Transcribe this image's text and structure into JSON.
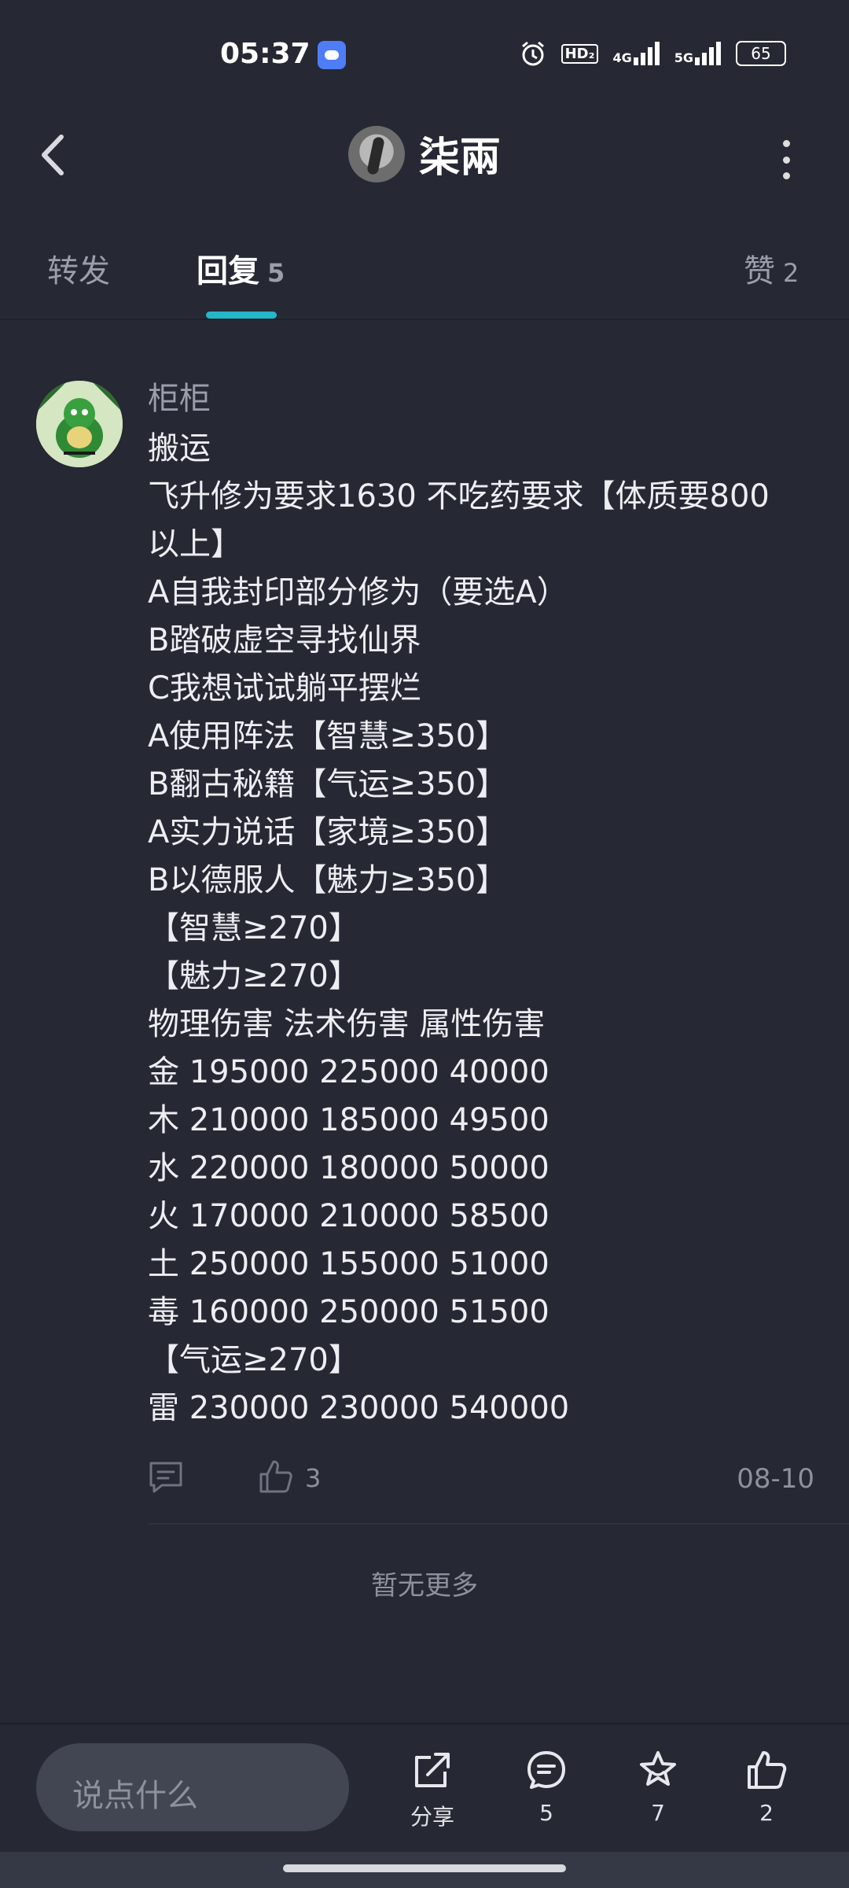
{
  "status_bar": {
    "time": "05:37",
    "hd_label": "HD₂",
    "net1": "4G",
    "net2": "5G",
    "battery": "65"
  },
  "header": {
    "title": "柒兩"
  },
  "tabs": [
    {
      "label": "转发",
      "count": ""
    },
    {
      "label": "回复",
      "count": "5"
    },
    {
      "label": "赞",
      "count": "2"
    }
  ],
  "comment": {
    "username": "柜柜",
    "lines": [
      "搬运",
      "飞升修为要求1630 不吃药要求【体质要800",
      "以上】",
      "A自我封印部分修为（要选A）",
      "B踏破虚空寻找仙界",
      "C我想试试躺平摆烂",
      "A使用阵法【智慧≥350】",
      "B翻古秘籍【气运≥350】",
      "A实力说话【家境≥350】",
      "B以德服人【魅力≥350】",
      "【智慧≥270】",
      "【魅力≥270】",
      "物理伤害 法术伤害 属性伤害",
      "金 195000 225000 40000",
      "木 210000 185000 49500",
      "水 220000 180000 50000",
      "火 170000 210000 58500",
      "土 250000 155000 51000",
      "毒 160000 250000 51500",
      "【气运≥270】",
      "雷 230000 230000 540000"
    ],
    "like_count": "3",
    "date": "08-10"
  },
  "no_more": "暂无更多",
  "bottom_bar": {
    "input_placeholder": "说点什么",
    "share_label": "分享",
    "comment_count": "5",
    "star_count": "7",
    "like_count": "2"
  },
  "colors": {
    "background": "#262833",
    "accent": "#24b6c9"
  }
}
